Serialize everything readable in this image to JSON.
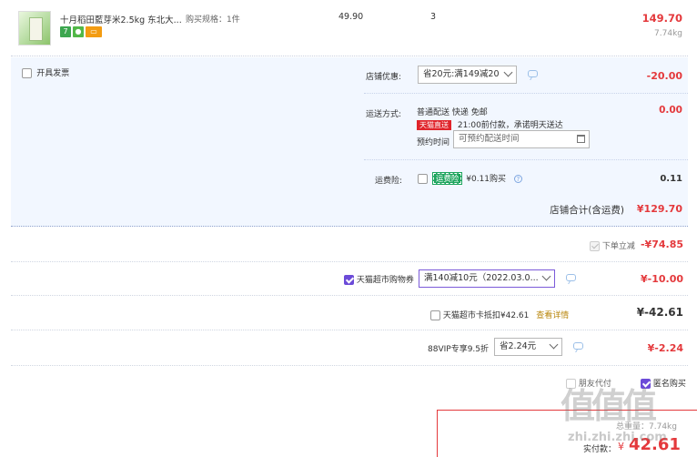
{
  "product": {
    "name": "十月稻田藍芽米2.5kg 东北大...",
    "spec_label": "购买规格：",
    "spec_value": "1件",
    "unit_price": "49.90",
    "quantity": "3",
    "subtotal": "149.70",
    "weight": "7.74kg",
    "badges": [
      "7",
      "",
      ""
    ]
  },
  "shop": {
    "invoice_label": "开具发票",
    "discount_label": "店铺优惠:",
    "discount_select": "省20元:满149减20",
    "discount_amount": "-20.00",
    "delivery_label": "运送方式:",
    "delivery_method": "普通配送 快递 免邮",
    "tmall_badge": "天猫直送",
    "delivery_promise": "21:00前付款，承诺明天送达",
    "schedule_label": "预约时间",
    "schedule_placeholder": "可预约配送时间",
    "delivery_amount": "0.00",
    "insurance_label": "运费险:",
    "insurance_badge": "运费险",
    "insurance_text": "¥0.11购买",
    "insurance_amount": "0.11",
    "total_label": "店铺合计(含运费)",
    "total_amount": "¥129.70"
  },
  "discounts": {
    "instant_label": "下单立减",
    "instant_amount": "-¥74.85",
    "coupon_label": "天猫超市购物券",
    "coupon_select": "满140减10元（2022.03.0...",
    "coupon_amount": "¥-10.00",
    "card_label": "天猫超市卡抵扣¥42.61",
    "card_link": "查看详情",
    "card_amount": "¥-42.61",
    "vip_label": "88VIP专享9.5折",
    "vip_select": "省2.24元",
    "vip_amount": "¥-2.24",
    "friend_pay_label": "朋友代付",
    "anonymous_label": "匿名购买"
  },
  "pay": {
    "weight_label": "总重量：7.74kg",
    "actual_label": "实付款：",
    "actual_currency": "¥",
    "actual_amount": "42.61"
  },
  "watermark": {
    "text": "值值值",
    "site": "zhi.zhi.zhi.com"
  },
  "colors": {
    "accent_red": "#e4393c",
    "shop_bg": "#f2f7ff",
    "purple": "#6c4bd8",
    "tmall_red": "#e0242b",
    "insurance_green": "#1ca45d"
  }
}
